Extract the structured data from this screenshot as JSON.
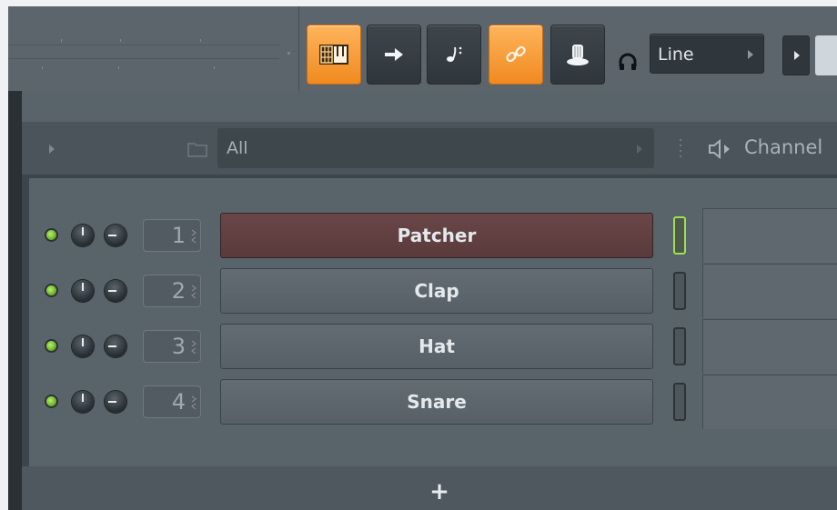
{
  "toolbar": {
    "buttons": [
      {
        "name": "piano-roll-icon",
        "active": true
      },
      {
        "name": "arrow-right-icon",
        "active": false
      },
      {
        "name": "note-icon",
        "active": false
      },
      {
        "name": "link-icon",
        "active": true
      },
      {
        "name": "knob-icon",
        "active": false
      }
    ],
    "snap_value": "Line"
  },
  "rack": {
    "filter_value": "All",
    "channel_label": "Channel",
    "add_label": "+"
  },
  "channels": [
    {
      "number": "1",
      "name": "Patcher",
      "selected": true
    },
    {
      "number": "2",
      "name": "Clap",
      "selected": false
    },
    {
      "number": "3",
      "name": "Hat",
      "selected": false
    },
    {
      "number": "4",
      "name": "Snare",
      "selected": false
    }
  ],
  "colors": {
    "accent": "#f5962b",
    "selected_channel": "#5e3f40",
    "led": "#8fd13f"
  }
}
